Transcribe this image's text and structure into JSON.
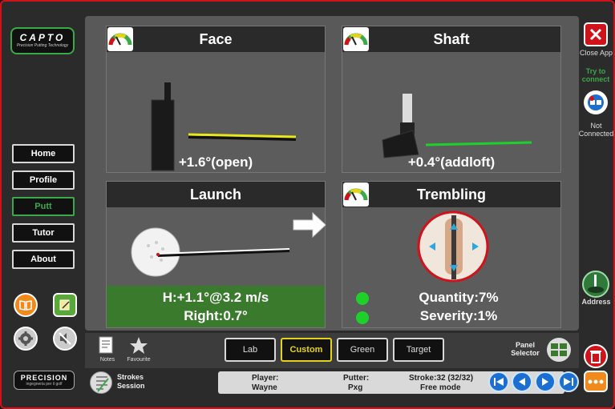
{
  "logo": {
    "brand": "CAPTO",
    "tagline": "Precision Putting Technology"
  },
  "nav": [
    {
      "label": "Home"
    },
    {
      "label": "Profile"
    },
    {
      "label": "Putt"
    },
    {
      "label": "Tutor"
    },
    {
      "label": "About"
    }
  ],
  "precision_logo": {
    "name": "PRECISION",
    "tagline": "ingegneria per il golf"
  },
  "panels": {
    "face": {
      "title": "Face",
      "value": "+1.6°(open)"
    },
    "shaft": {
      "title": "Shaft",
      "value": "+0.4°(addloft)"
    },
    "launch": {
      "title": "Launch",
      "line1": "H:+1.1°@3.2 m/s",
      "line2": "Right:0.7°"
    },
    "trembling": {
      "title": "Trembling",
      "quantity": "Quantity:7%",
      "severity": "Severity:1%"
    }
  },
  "right": {
    "close_label": "Close App",
    "try_connect": "Try to connect",
    "connection_status": "Not Connected",
    "address_label": "Address"
  },
  "toolbar": {
    "notes_label": "Notes",
    "favourite_label": "Favourite",
    "tabs": [
      "Lab",
      "Custom",
      "Green",
      "Target"
    ],
    "active_tab": "Custom",
    "panel_selector_label": "Panel Selector"
  },
  "status": {
    "strokes_session_label": "Strokes Session",
    "player_label": "Player:",
    "player_value": "Wayne",
    "putter_label": "Putter:",
    "putter_value": "Pxg",
    "stroke_label": "Stroke:32 (32/32)",
    "mode_value": "Free mode"
  },
  "colors": {
    "accent_green": "#3aa94a",
    "active_yellow": "#e3d31a",
    "frame_red": "#d0121b",
    "nav_blue": "#1a6fd0"
  }
}
